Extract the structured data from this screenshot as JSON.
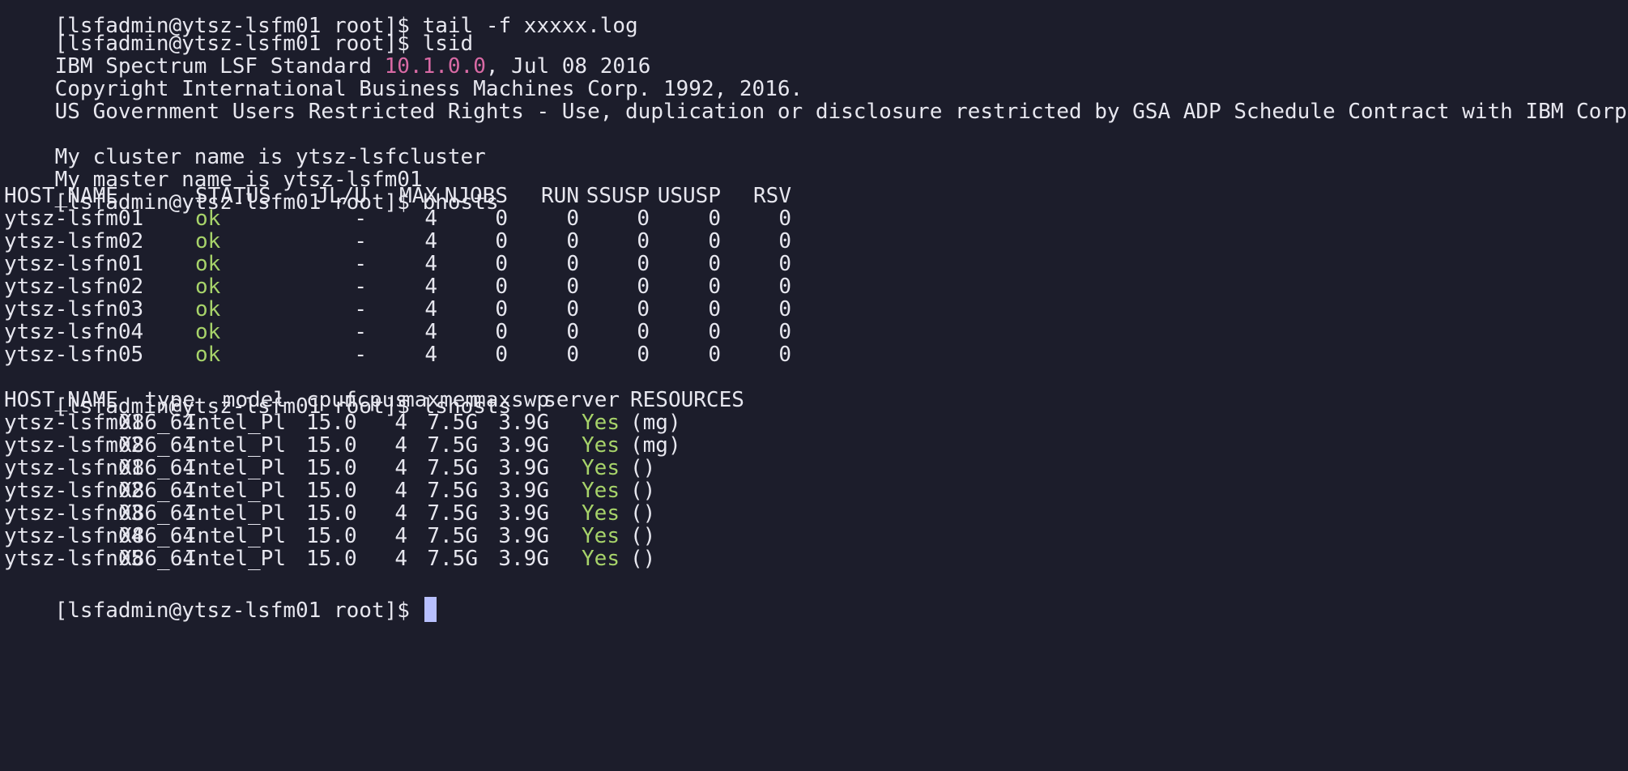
{
  "prompt": "[lsfadmin@ytsz-lsfm01 root]$ ",
  "partial_top_line": "[lsfadmin@ytsz-lsfm01 root]$ tail -f xxxxx.log",
  "lsid": {
    "command": "lsid",
    "product_prefix": "IBM Spectrum LSF Standard ",
    "version": "10.1.0.0",
    "product_suffix": ", Jul 08 2016",
    "copyright": "Copyright International Business Machines Corp. 1992, 2016.",
    "restricted": "US Government Users Restricted Rights - Use, duplication or disclosure restricted by GSA ADP Schedule Contract with IBM Corp.",
    "cluster_line": "My cluster name is ytsz-lsfcluster",
    "master_line": "My master name is ytsz-lsfm01"
  },
  "bhosts": {
    "command": "bhosts",
    "headers": [
      "HOST_NAME",
      "STATUS",
      "JL/U",
      "MAX",
      "NJOBS",
      "RUN",
      "SSUSP",
      "USUSP",
      "RSV"
    ],
    "rows": [
      [
        "ytsz-lsfm01",
        "ok",
        "-",
        "4",
        "0",
        "0",
        "0",
        "0",
        "0"
      ],
      [
        "ytsz-lsfm02",
        "ok",
        "-",
        "4",
        "0",
        "0",
        "0",
        "0",
        "0"
      ],
      [
        "ytsz-lsfn01",
        "ok",
        "-",
        "4",
        "0",
        "0",
        "0",
        "0",
        "0"
      ],
      [
        "ytsz-lsfn02",
        "ok",
        "-",
        "4",
        "0",
        "0",
        "0",
        "0",
        "0"
      ],
      [
        "ytsz-lsfn03",
        "ok",
        "-",
        "4",
        "0",
        "0",
        "0",
        "0",
        "0"
      ],
      [
        "ytsz-lsfn04",
        "ok",
        "-",
        "4",
        "0",
        "0",
        "0",
        "0",
        "0"
      ],
      [
        "ytsz-lsfn05",
        "ok",
        "-",
        "4",
        "0",
        "0",
        "0",
        "0",
        "0"
      ]
    ]
  },
  "lshosts": {
    "command": "lshosts",
    "headers": [
      "HOST_NAME",
      "type",
      "model",
      "cpuf",
      "ncpus",
      "maxmem",
      "maxswp",
      "server",
      "RESOURCES"
    ],
    "rows": [
      [
        "ytsz-lsfm01",
        "X86_64",
        "Intel_Pl",
        "15.0",
        "4",
        "7.5G",
        "3.9G",
        "Yes",
        "(mg)"
      ],
      [
        "ytsz-lsfm02",
        "X86_64",
        "Intel_Pl",
        "15.0",
        "4",
        "7.5G",
        "3.9G",
        "Yes",
        "(mg)"
      ],
      [
        "ytsz-lsfn01",
        "X86_64",
        "Intel_Pl",
        "15.0",
        "4",
        "7.5G",
        "3.9G",
        "Yes",
        "()"
      ],
      [
        "ytsz-lsfn02",
        "X86_64",
        "Intel_Pl",
        "15.0",
        "4",
        "7.5G",
        "3.9G",
        "Yes",
        "()"
      ],
      [
        "ytsz-lsfn03",
        "X86_64",
        "Intel_Pl",
        "15.0",
        "4",
        "7.5G",
        "3.9G",
        "Yes",
        "()"
      ],
      [
        "ytsz-lsfn04",
        "X86_64",
        "Intel_Pl",
        "15.0",
        "4",
        "7.5G",
        "3.9G",
        "Yes",
        "()"
      ],
      [
        "ytsz-lsfn05",
        "X86_64",
        "Intel_Pl",
        "15.0",
        "4",
        "7.5G",
        "3.9G",
        "Yes",
        "()"
      ]
    ]
  },
  "colors": {
    "background": "#1c1d2b",
    "foreground": "#e7e7ef",
    "version_accent": "#d96aa5",
    "status_ok": "#a7d36a",
    "cursor": "#b8c0ff"
  }
}
